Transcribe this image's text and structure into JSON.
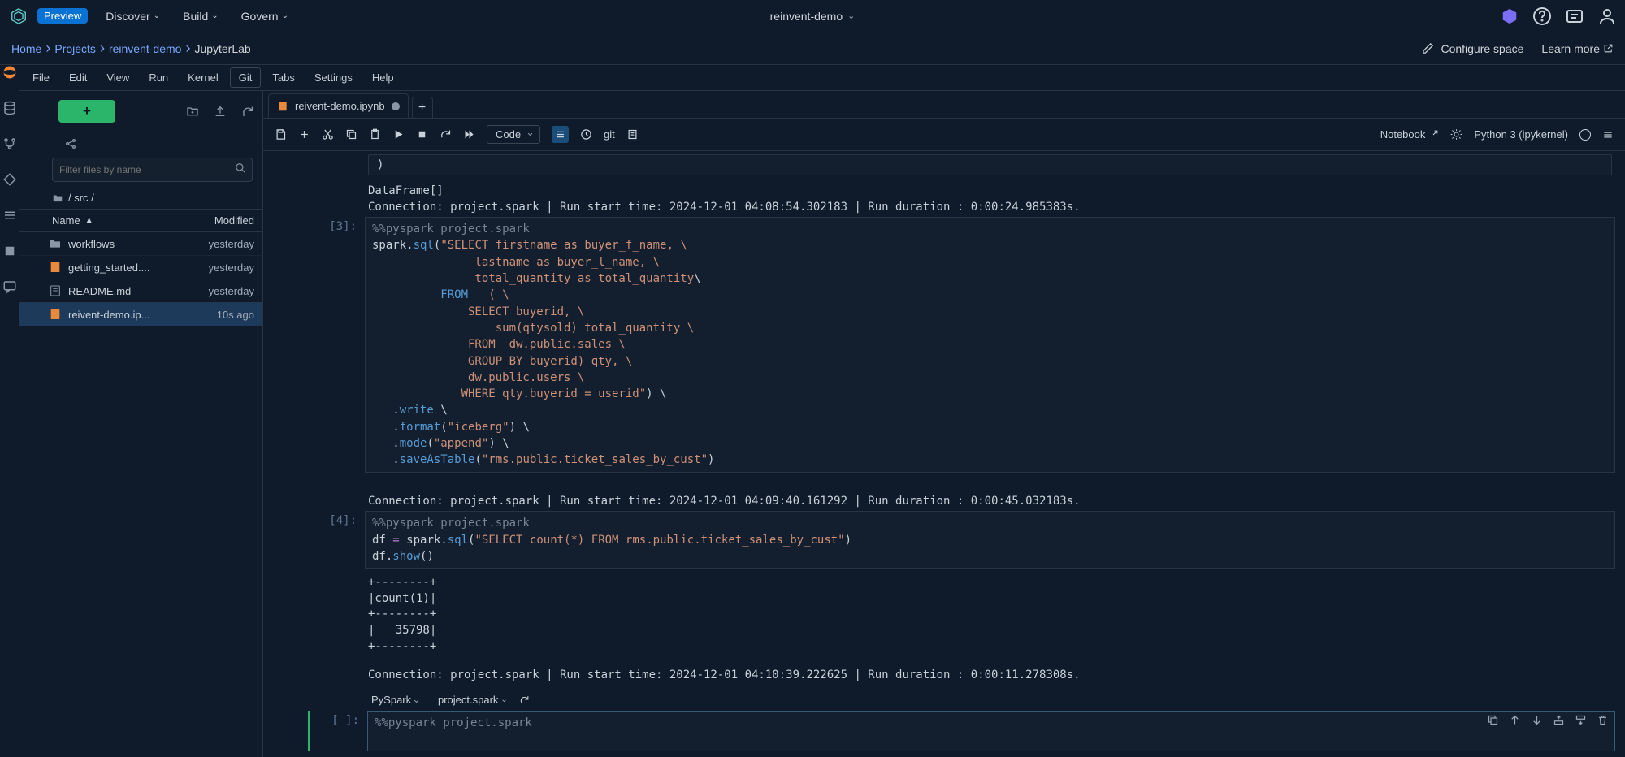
{
  "appBar": {
    "preview": "Preview",
    "discover": "Discover",
    "build": "Build",
    "govern": "Govern",
    "project": "reinvent-demo"
  },
  "breadcrumb": {
    "home": "Home",
    "projects": "Projects",
    "project": "reinvent-demo",
    "current": "JupyterLab",
    "configure": "Configure space",
    "learnMore": "Learn more"
  },
  "menu": {
    "file": "File",
    "edit": "Edit",
    "view": "View",
    "run": "Run",
    "kernel": "Kernel",
    "git": "Git",
    "tabs": "Tabs",
    "settings": "Settings",
    "help": "Help"
  },
  "fileBrowser": {
    "searchPlaceholder": "Filter files by name",
    "path": "/ src /",
    "colName": "Name",
    "colModified": "Modified",
    "rows": [
      {
        "name": "workflows",
        "mod": "yesterday",
        "type": "folder"
      },
      {
        "name": "getting_started....",
        "mod": "yesterday",
        "type": "nb"
      },
      {
        "name": "README.md",
        "mod": "yesterday",
        "type": "md"
      },
      {
        "name": "reivent-demo.ip...",
        "mod": "10s ago",
        "type": "nb"
      }
    ]
  },
  "tab": {
    "name": "reivent-demo.ipynb"
  },
  "toolbar": {
    "cellType": "Code",
    "notebookBadge": "Notebook",
    "kernel": "Python 3 (ipykernel)"
  },
  "cells": {
    "out0_trunc": "            )",
    "out0": "DataFrame[]\nConnection: project.spark | Run start time: 2024-12-01 04:08:54.302183 | Run duration : 0:00:24.985383s.",
    "prompt3": "[3]:",
    "code3_magic": "%%pyspark project.spark",
    "out3": "Connection: project.spark | Run start time: 2024-12-01 04:09:40.161292 | Run duration : 0:00:45.032183s.",
    "prompt4": "[4]:",
    "code4_magic": "%%pyspark project.spark",
    "out4_table": "+--------+\n|count(1)|\n+--------+\n|   35798|\n+--------+",
    "out4_foot": "Connection: project.spark | Run start time: 2024-12-01 04:10:39.222625 | Run duration : 0:00:11.278308s.",
    "prompt5": "[ ]:",
    "code5_magic": "%%pyspark project.spark",
    "footerKernel": "PySpark",
    "footerConn": "project.spark"
  }
}
